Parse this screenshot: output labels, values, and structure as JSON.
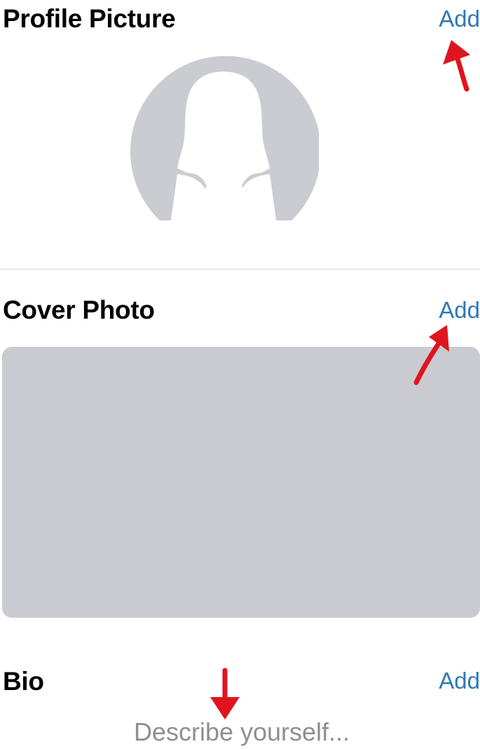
{
  "profile_picture": {
    "title": "Profile Picture",
    "add_label": "Add"
  },
  "cover_photo": {
    "title": "Cover Photo",
    "add_label": "Add"
  },
  "bio": {
    "title": "Bio",
    "add_label": "Add",
    "placeholder": "Describe yourself..."
  },
  "colors": {
    "accent": "#2f78b8",
    "placeholder_gray": "#cacbd0",
    "annotation_red": "#e0141e"
  },
  "icons": {
    "avatar": "person-silhouette-icon",
    "annotation": "red-arrow-icon"
  }
}
